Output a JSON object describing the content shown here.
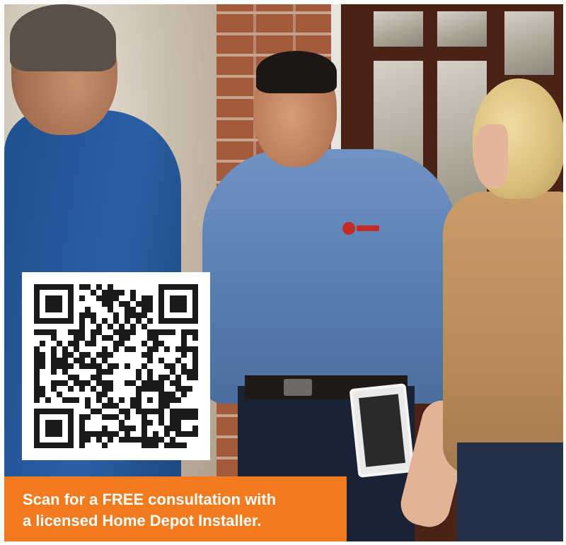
{
  "cta": {
    "line1": "Scan for a FREE consultation with",
    "line2": "a licensed Home Depot Installer."
  },
  "colors": {
    "cta_background": "#f27a1f",
    "cta_text": "#ffffff",
    "qr_dark": "#1a1a1a",
    "qr_light": "#ffffff"
  },
  "qr_code": {
    "modules": 29,
    "seed": 1379
  }
}
